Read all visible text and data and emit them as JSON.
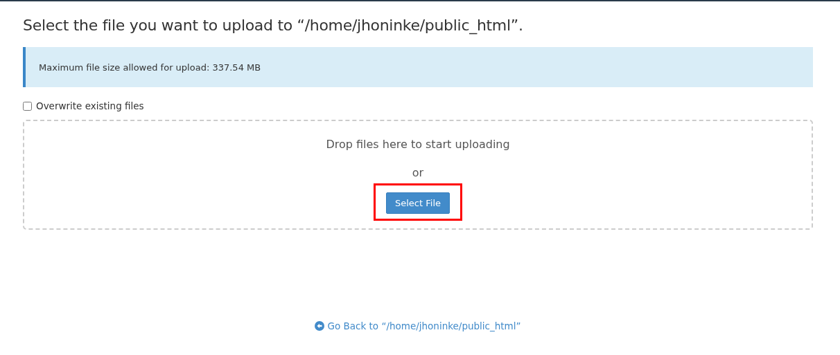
{
  "title": "Select the file you want to upload to “/home/jhoninke/public_html”.",
  "alert": {
    "text": "Maximum file size allowed for upload: 337.54 MB"
  },
  "overwrite": {
    "label": "Overwrite existing files",
    "checked": false
  },
  "dropzone": {
    "text": "Drop files here to start uploading",
    "or": "or",
    "button": {
      "label": "Select File",
      "highlighted": true
    }
  },
  "back_link": {
    "label": "Go Back to “/home/jhoninke/public_html”"
  }
}
